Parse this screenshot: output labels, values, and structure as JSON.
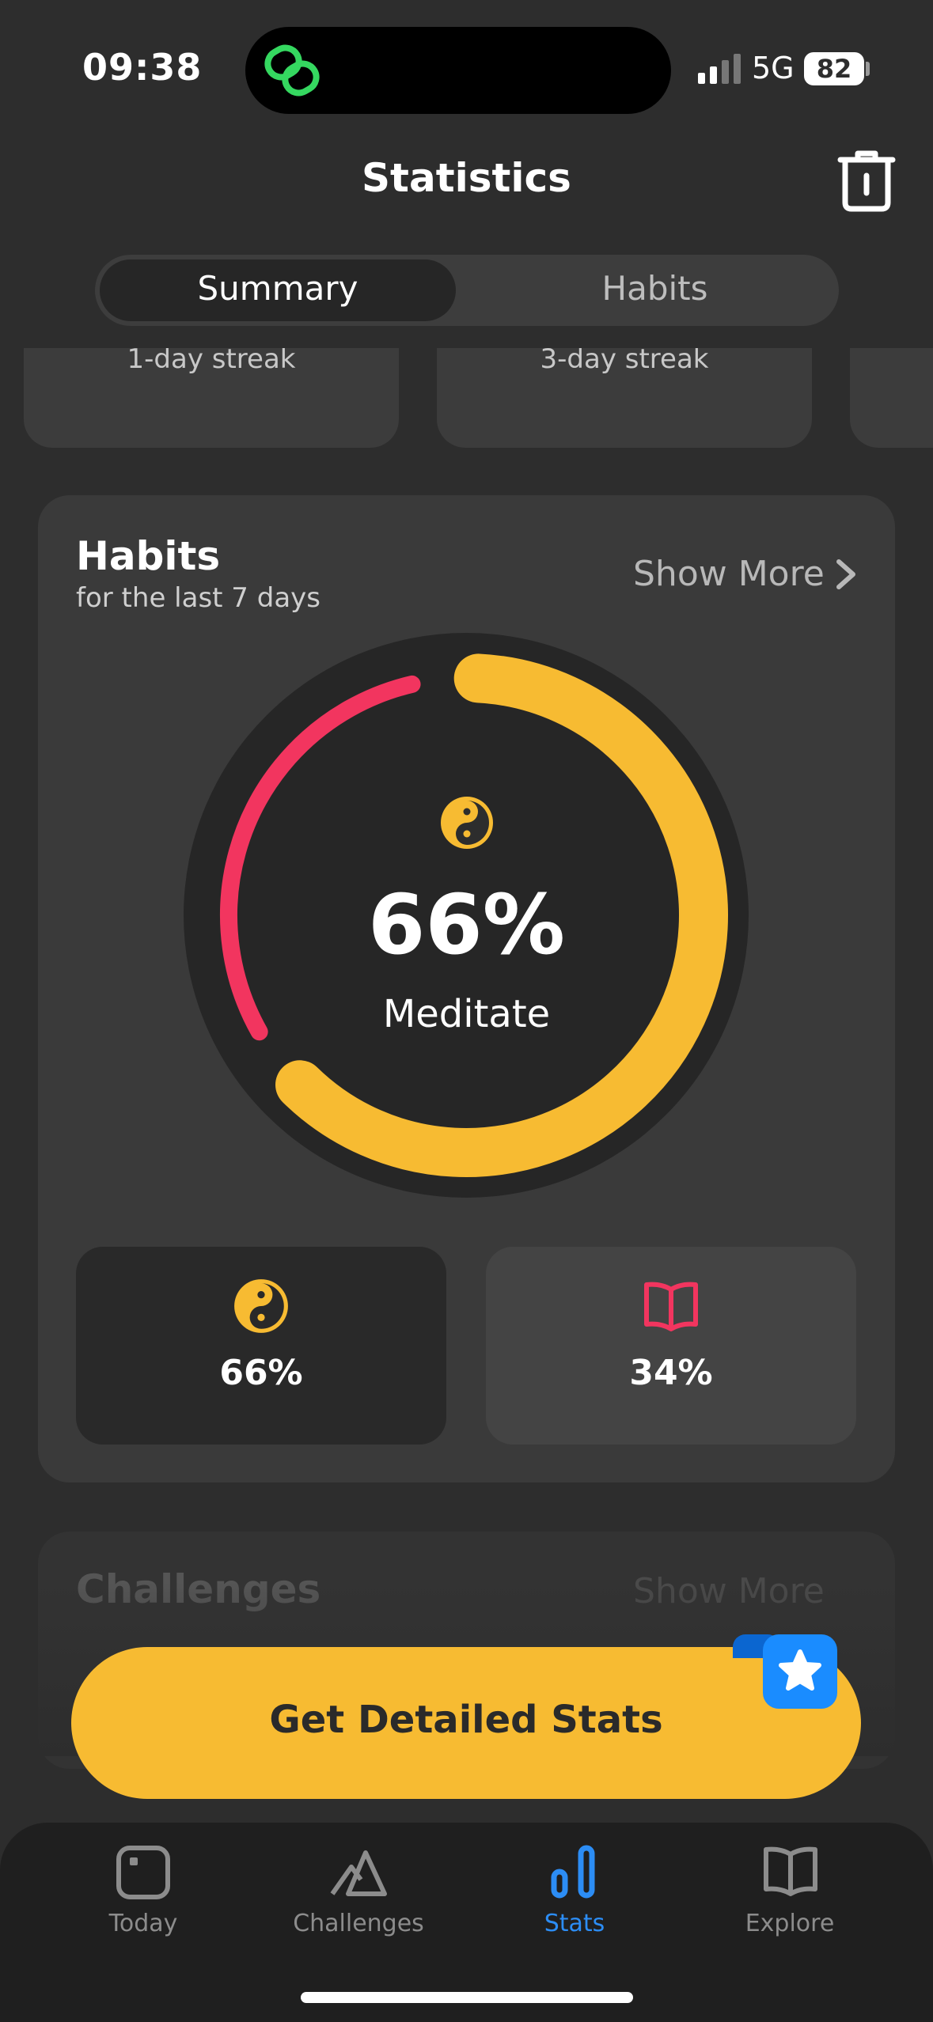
{
  "status_bar": {
    "time": "09:38",
    "network": "5G",
    "battery": "82"
  },
  "header": {
    "title": "Statistics",
    "trash_icon": "trash-icon"
  },
  "segmented": {
    "options": [
      "Summary",
      "Habits"
    ],
    "selected": "Summary"
  },
  "streaks": [
    {
      "label": "1-day streak"
    },
    {
      "label": "3-day streak"
    }
  ],
  "habits_card": {
    "title": "Habits",
    "subtitle": "for the last 7 days",
    "show_more": "Show More",
    "donut": {
      "center_percent": "66%",
      "center_name": "Meditate",
      "segments": [
        {
          "name": "Meditate",
          "percent": 66,
          "color": "#f7bb32",
          "icon": "yin-yang-icon"
        },
        {
          "name": "Read",
          "percent": 34,
          "color": "#f2355f",
          "icon": "book-icon"
        }
      ]
    },
    "tiles": [
      {
        "icon": "yin-yang-icon",
        "percent": "66%",
        "color": "#f7bb32"
      },
      {
        "icon": "book-icon",
        "percent": "34%",
        "color": "#f2355f"
      }
    ]
  },
  "challenges_card": {
    "title": "Challenges",
    "show_more": "Show More"
  },
  "cta": {
    "label": "Get Detailed Stats",
    "badge_icon": "star-icon"
  },
  "tabbar": {
    "items": [
      {
        "label": "Today",
        "icon": "square-icon"
      },
      {
        "label": "Challenges",
        "icon": "mountain-icon"
      },
      {
        "label": "Stats",
        "icon": "bar-chart-icon",
        "active": true
      },
      {
        "label": "Explore",
        "icon": "book-icon"
      }
    ]
  },
  "colors": {
    "accent": "#f7bb32",
    "secondary": "#f2355f",
    "active_tab": "#2c8df5",
    "background": "#2d2d2d"
  }
}
